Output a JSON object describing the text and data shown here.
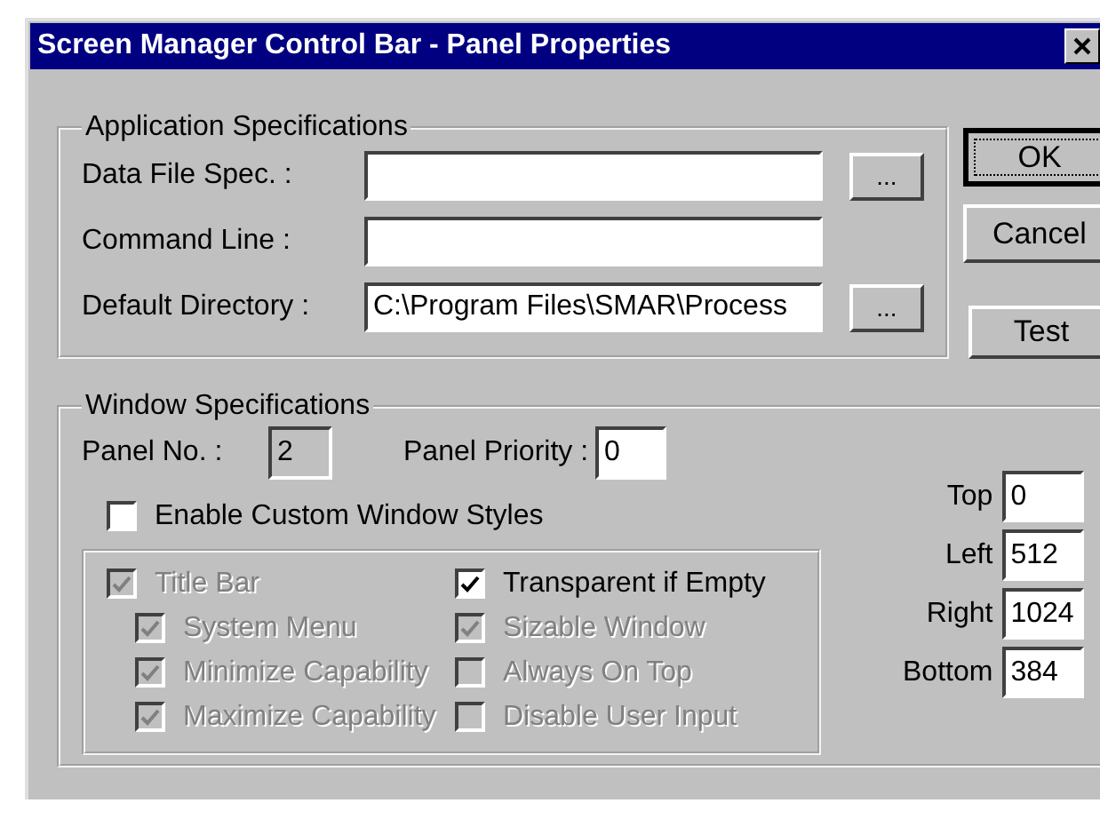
{
  "window": {
    "title": "Screen Manager Control Bar - Panel Properties"
  },
  "application_specifications": {
    "title": "Application Specifications",
    "fields": [
      {
        "label": "Data File Spec. :",
        "browse": "..."
      },
      {
        "label": "Command Line :"
      },
      {
        "label": "Default Directory :",
        "value": "C:\\Program Files\\SMAR\\Process",
        "browse": "..."
      }
    ]
  },
  "buttons": [
    {
      "label": "OK",
      "default": true
    },
    {
      "label": "Cancel",
      "default": false
    },
    {
      "label": "Test",
      "default": false
    }
  ],
  "window_specifications": {
    "title": "Window Specifications",
    "panel_no": {
      "label": "Panel No. :",
      "value": "2",
      "disabled": true
    },
    "panel_priority": {
      "label": "Panel Priority :",
      "value": "0",
      "disabled": false
    },
    "enable_custom_styles": {
      "label": "Enable Custom Window Styles",
      "checked": false,
      "disabled": false
    },
    "style_options": {
      "left": [
        {
          "label": "Title Bar",
          "checked": true,
          "disabled": true,
          "children": [
            {
              "label": "System Menu",
              "checked": true,
              "disabled": true
            },
            {
              "label": "Minimize Capability",
              "checked": true,
              "disabled": true
            },
            {
              "label": "Maximize Capability",
              "checked": true,
              "disabled": true
            }
          ]
        }
      ],
      "right": [
        {
          "label": "Transparent if Empty",
          "checked": true,
          "disabled": false
        },
        {
          "label": "Sizable Window",
          "checked": true,
          "disabled": true
        },
        {
          "label": "Always On Top",
          "checked": false,
          "disabled": true
        },
        {
          "label": "Disable User Input",
          "checked": false,
          "disabled": true
        }
      ]
    },
    "position": [
      {
        "label": "Top",
        "value": "0"
      },
      {
        "label": "Left",
        "value": "512"
      },
      {
        "label": "Right",
        "value": "1024"
      },
      {
        "label": "Bottom",
        "value": "384"
      }
    ]
  }
}
